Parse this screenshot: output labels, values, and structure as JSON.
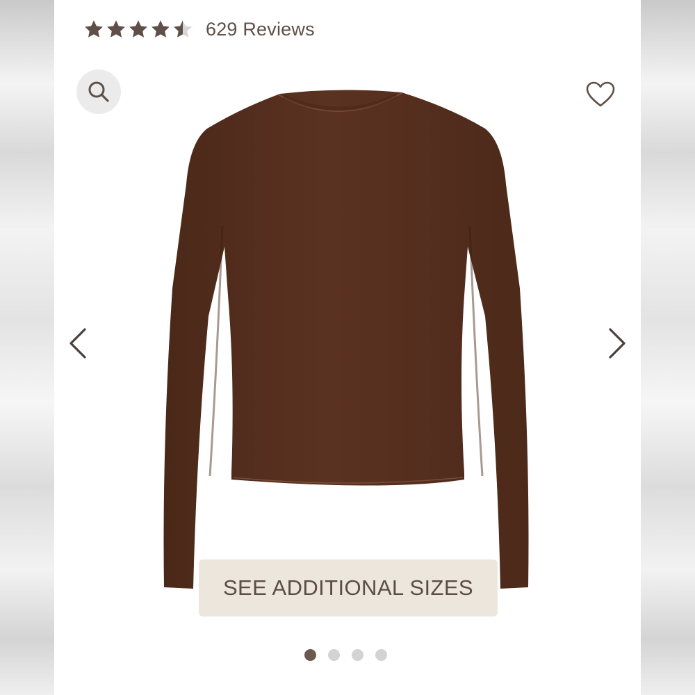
{
  "rating": {
    "stars_value": 4.5,
    "stars_max": 5,
    "reviews_label": "629 Reviews",
    "star_color": "#5e5048",
    "star_empty_color": "#d6d6d6"
  },
  "icons": {
    "search": "search-icon",
    "heart": "heart-icon",
    "prev": "chevron-left-icon",
    "next": "chevron-right-icon"
  },
  "product": {
    "garment_color": "#58301f"
  },
  "cta": {
    "label": "SEE ADDITIONAL SIZES",
    "background": "#ece6dd",
    "text_color": "#5c4d44"
  },
  "carousel": {
    "total_slides": 4,
    "active_slide": 1,
    "active_color": "#6a5a4f",
    "inactive_color": "#d3d3d3"
  }
}
